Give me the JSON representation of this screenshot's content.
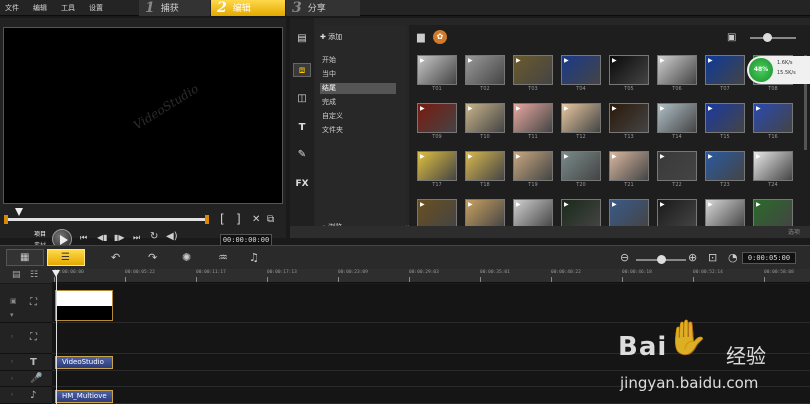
{
  "menu": {
    "file": "文件",
    "edit": "编辑",
    "tools": "工具",
    "settings": "设置"
  },
  "steps": [
    {
      "num": "1",
      "label": "捕获"
    },
    {
      "num": "2",
      "label": "编辑"
    },
    {
      "num": "3",
      "label": "分享"
    }
  ],
  "preview": {
    "watermark": "VideoStudio",
    "mode_project": "项目",
    "mode_clip": "素材",
    "timecode": "00:00:00:00",
    "bracket_in": "[",
    "bracket_out": "]"
  },
  "library": {
    "add_label": "添加",
    "tree": [
      "开始",
      "当中",
      "结尾",
      "完成",
      "自定义",
      "文件夹"
    ],
    "selected_index": 2,
    "browse_label": "浏览",
    "status": "选项",
    "thumbs": [
      {
        "label": "T01",
        "bg": "#c8c8c8"
      },
      {
        "label": "T02",
        "bg": "#9a9a9a"
      },
      {
        "label": "T03",
        "bg": "#6b5a2c"
      },
      {
        "label": "T04",
        "bg": "#1a3a8a"
      },
      {
        "label": "T05",
        "bg": "#0a0a0a"
      },
      {
        "label": "T06",
        "bg": "#d0d0d0"
      },
      {
        "label": "T07",
        "bg": "#0d3a9a"
      },
      {
        "label": "T08",
        "bg": "#1a7a2a"
      },
      {
        "label": "T09",
        "bg": "#7a1a10"
      },
      {
        "label": "T10",
        "bg": "#c9b48a"
      },
      {
        "label": "T11",
        "bg": "#e8a8a0"
      },
      {
        "label": "T12",
        "bg": "#e8c8a0"
      },
      {
        "label": "T13",
        "bg": "#2a1a0a"
      },
      {
        "label": "T14",
        "bg": "#b0c0c8"
      },
      {
        "label": "T15",
        "bg": "#1a3aa0"
      },
      {
        "label": "T16",
        "bg": "#2a4ab0"
      },
      {
        "label": "T17",
        "bg": "#e0c040"
      },
      {
        "label": "T18",
        "bg": "#d8b850"
      },
      {
        "label": "T19",
        "bg": "#c8a880"
      },
      {
        "label": "T20",
        "bg": "#7a8a8a"
      },
      {
        "label": "T21",
        "bg": "#d8b8a0"
      },
      {
        "label": "T22",
        "bg": "#3a3a3a"
      },
      {
        "label": "T23",
        "bg": "#2a5aa0"
      },
      {
        "label": "T24",
        "bg": "#e8e8e8"
      },
      {
        "label": "",
        "bg": "#6a5020"
      },
      {
        "label": "",
        "bg": "#c8a060"
      },
      {
        "label": "",
        "bg": "#d0d0d0"
      },
      {
        "label": "",
        "bg": "#1a2a1a"
      },
      {
        "label": "",
        "bg": "#3a5a8a"
      },
      {
        "label": "",
        "bg": "#1a1a1a"
      },
      {
        "label": "",
        "bg": "#d8d8d8"
      },
      {
        "label": "",
        "bg": "#2a6a2a"
      }
    ]
  },
  "network": {
    "percent": "48%",
    "up": "1.6K/s",
    "down": "15.5K/s"
  },
  "timeline": {
    "timecode": "0:00:05:00",
    "ruler": [
      "00:00:00:00",
      "00:00:05:22",
      "00:00:11:17",
      "00:00:17:13",
      "00:00:23:09",
      "00:00:29:03",
      "00:00:35:01",
      "00:00:40:22",
      "00:00:46:18",
      "00:00:52:14",
      "00:00:58:08"
    ],
    "title_clip_1": "VideoStudio",
    "title_clip_2": "HM_Multiove"
  },
  "watermark": {
    "brand": "Bai",
    "brand2": "经验",
    "url": "jingyan.baidu.com"
  }
}
